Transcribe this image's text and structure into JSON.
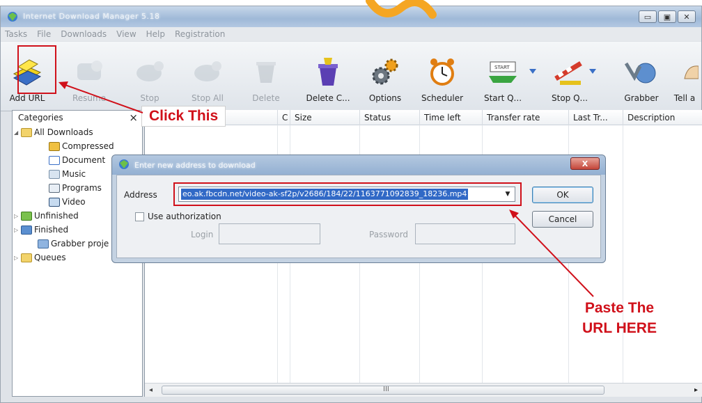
{
  "window": {
    "title": "Internet Download Manager 5.18",
    "controls": [
      "minimize",
      "maximize",
      "close"
    ]
  },
  "menu": [
    "Tasks",
    "File",
    "Downloads",
    "View",
    "Help",
    "Registration"
  ],
  "toolbar": {
    "buttons": [
      {
        "label": "Add URL",
        "icon": "add-url-icon",
        "enabled": true
      },
      {
        "label": "Resume",
        "icon": "resume-icon",
        "enabled": false
      },
      {
        "label": "Stop",
        "icon": "stop-icon",
        "enabled": false
      },
      {
        "label": "Stop All",
        "icon": "stop-all-icon",
        "enabled": false
      },
      {
        "label": "Delete",
        "icon": "delete-icon",
        "enabled": false
      },
      {
        "label": "Delete C...",
        "icon": "delete-completed-icon",
        "enabled": true
      },
      {
        "label": "Options",
        "icon": "options-gear-icon",
        "enabled": true
      },
      {
        "label": "Scheduler",
        "icon": "scheduler-clock-icon",
        "enabled": true
      },
      {
        "label": "Start Q...",
        "icon": "start-queue-icon",
        "enabled": true
      },
      {
        "label": "Stop Q...",
        "icon": "stop-queue-icon",
        "enabled": true
      },
      {
        "label": "Grabber",
        "icon": "grabber-icon",
        "enabled": true
      },
      {
        "label": "Tell a",
        "icon": "tell-a-friend-icon",
        "enabled": true
      }
    ]
  },
  "categories": {
    "header": "Categories",
    "close_glyph": "×",
    "items": [
      {
        "label": "All Downloads"
      },
      {
        "label": "Compressed"
      },
      {
        "label": "Document"
      },
      {
        "label": "Music"
      },
      {
        "label": "Programs"
      },
      {
        "label": "Video"
      },
      {
        "label": "Unfinished"
      },
      {
        "label": "Finished"
      },
      {
        "label": "Grabber proje"
      },
      {
        "label": "Queues"
      }
    ]
  },
  "list": {
    "columns": [
      "C",
      "Size",
      "Status",
      "Time left",
      "Transfer rate",
      "Last Tr...",
      "Description"
    ],
    "scroll_grip": "III"
  },
  "annotations": {
    "click_this": "Click This",
    "paste_line1": "Paste The",
    "paste_line2": "URL HERE"
  },
  "dialog": {
    "title": "Enter new address to download",
    "close_label": "X",
    "address_label": "Address",
    "address_value": "eo.ak.fbcdn.net/video-ak-sf2p/v2686/184/22/1163771092839_18236.mp4",
    "ok_label": "OK",
    "cancel_label": "Cancel",
    "use_auth_label": "Use authorization",
    "use_auth_checked": false,
    "login_label": "Login",
    "password_label": "Password"
  },
  "colors": {
    "annotation_red": "#d0101a",
    "selection_blue": "#3169c6"
  }
}
